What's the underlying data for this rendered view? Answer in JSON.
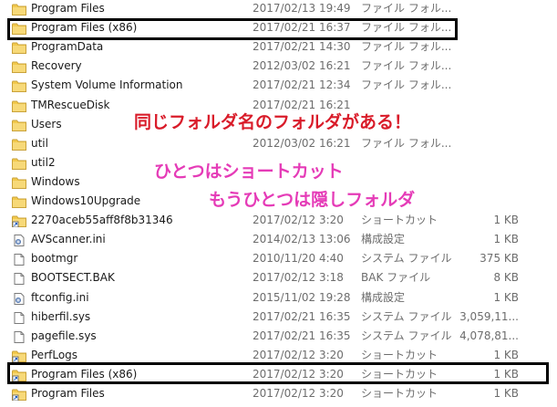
{
  "files": [
    {
      "name": "Program Files",
      "date": "2017/02/13 19:49",
      "type": "ファイル フォル...",
      "size": "",
      "icon": "folder-icon"
    },
    {
      "name": "Program Files (x86)",
      "date": "2017/02/21 16:37",
      "type": "ファイル フォル...",
      "size": "",
      "icon": "folder-icon"
    },
    {
      "name": "ProgramData",
      "date": "2017/02/21 14:30",
      "type": "ファイル フォル...",
      "size": "",
      "icon": "folder-icon"
    },
    {
      "name": "Recovery",
      "date": "2012/03/02 16:21",
      "type": "ファイル フォル...",
      "size": "",
      "icon": "folder-icon"
    },
    {
      "name": "System Volume Information",
      "date": "2017/02/21 12:34",
      "type": "ファイル フォル...",
      "size": "",
      "icon": "folder-icon"
    },
    {
      "name": "TMRescueDisk",
      "date": "2017/02/21 16:21",
      "type": "",
      "size": "",
      "icon": "folder-icon"
    },
    {
      "name": "Users",
      "date": "",
      "type": "",
      "size": "",
      "icon": "folder-icon"
    },
    {
      "name": "util",
      "date": "2012/03/02 16:21",
      "type": "ファイル フォル...",
      "size": "",
      "icon": "folder-icon"
    },
    {
      "name": "util2",
      "date": "",
      "type": "",
      "size": "",
      "icon": "folder-icon"
    },
    {
      "name": "Windows",
      "date": "",
      "type": "",
      "size": "",
      "icon": "folder-icon"
    },
    {
      "name": "Windows10Upgrade",
      "date": "",
      "type": "",
      "size": "",
      "icon": "folder-icon"
    },
    {
      "name": "2270aceb55aff8f8b31346",
      "date": "2017/02/12 3:20",
      "type": "ショートカット",
      "size": "1 KB",
      "icon": "folder-shortcut-icon"
    },
    {
      "name": "AVScanner.ini",
      "date": "2014/02/13 13:06",
      "type": "構成設定",
      "size": "1 KB",
      "icon": "settings-file-icon"
    },
    {
      "name": "bootmgr",
      "date": "2010/11/20 4:40",
      "type": "システム ファイル",
      "size": "375 KB",
      "icon": "file-icon"
    },
    {
      "name": "BOOTSECT.BAK",
      "date": "2017/02/12 3:18",
      "type": "BAK ファイル",
      "size": "8 KB",
      "icon": "file-icon"
    },
    {
      "name": "ftconfig.ini",
      "date": "2015/11/02 19:28",
      "type": "構成設定",
      "size": "1 KB",
      "icon": "settings-file-icon"
    },
    {
      "name": "hiberfil.sys",
      "date": "2017/02/21 16:35",
      "type": "システム ファイル",
      "size": "3,059,11...",
      "icon": "file-icon"
    },
    {
      "name": "pagefile.sys",
      "date": "2017/02/21 16:35",
      "type": "システム ファイル",
      "size": "4,078,81...",
      "icon": "file-icon"
    },
    {
      "name": "PerfLogs",
      "date": "2017/02/12 3:20",
      "type": "ショートカット",
      "size": "1 KB",
      "icon": "folder-shortcut-icon"
    },
    {
      "name": "Program Files (x86)",
      "date": "2017/02/12 3:20",
      "type": "ショートカット",
      "size": "1 KB",
      "icon": "folder-shortcut-icon"
    },
    {
      "name": "Program Files",
      "date": "2017/02/12 3:20",
      "type": "ショートカット",
      "size": "1 KB",
      "icon": "folder-shortcut-icon"
    }
  ],
  "annotations": {
    "line1": "同じフォルダ名のフォルダがある！",
    "line2": "ひとつはショートカット",
    "line3": "もうひとつは隠しフォルダ"
  },
  "colors": {
    "annotation_red": "#d91c2a",
    "annotation_pink": "#e53bb7",
    "folder_yellow": "#f2c94c"
  }
}
